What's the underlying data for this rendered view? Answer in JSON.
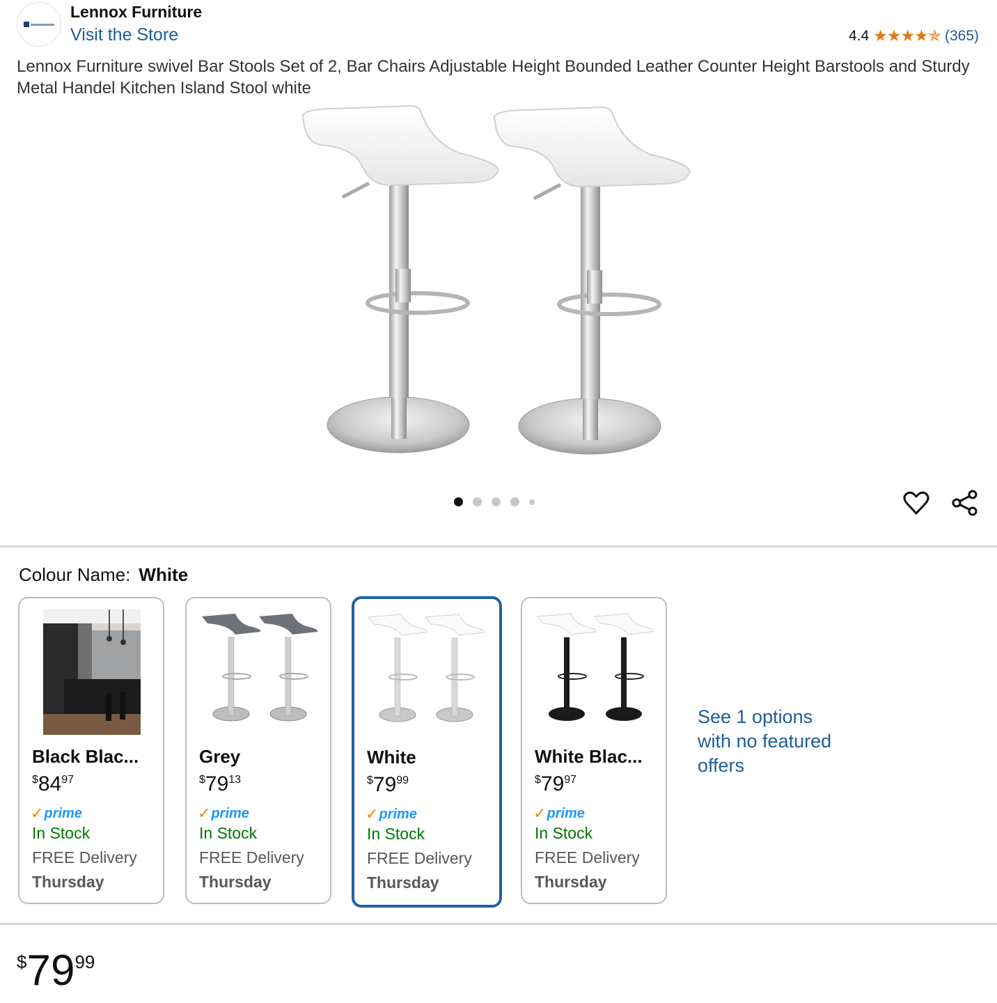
{
  "header": {
    "store_name": "Lennox Furniture",
    "visit_store": "Visit the Store",
    "rating": "4.4",
    "stars": "★★★★✯",
    "rating_count": "(365)"
  },
  "product": {
    "title": "Lennox Furniture swivel Bar Stools Set of 2, Bar Chairs Adjustable Height Bounded Leather Counter Height Barstools and Sturdy Metal Handel Kitchen Island Stool white",
    "image_dots": 5,
    "active_dot": 0
  },
  "colour": {
    "label": "Colour Name:",
    "selected": "White"
  },
  "variants": [
    {
      "name": "Black Blac...",
      "currency": "$",
      "whole": "84",
      "fraction": "97",
      "prime": "prime",
      "stock": "In Stock",
      "delivery": "FREE Delivery",
      "day": "Thursday",
      "selected": false
    },
    {
      "name": "Grey",
      "currency": "$",
      "whole": "79",
      "fraction": "13",
      "prime": "prime",
      "stock": "In Stock",
      "delivery": "FREE Delivery",
      "day": "Thursday",
      "selected": false
    },
    {
      "name": "White",
      "currency": "$",
      "whole": "79",
      "fraction": "99",
      "prime": "prime",
      "stock": "In Stock",
      "delivery": "FREE Delivery",
      "day": "Thursday",
      "selected": true
    },
    {
      "name": "White Blac...",
      "currency": "$",
      "whole": "79",
      "fraction": "97",
      "prime": "prime",
      "stock": "In Stock",
      "delivery": "FREE Delivery",
      "day": "Thursday",
      "selected": false
    }
  ],
  "see_options": "See 1 options with no featured offers",
  "price": {
    "currency": "$",
    "whole": "79",
    "fraction": "99"
  },
  "colors": {
    "link": "#1f5c99",
    "stars": "#e47911",
    "stock": "#007600",
    "prime": "#1a98ff",
    "selected_border": "#2162a1"
  }
}
